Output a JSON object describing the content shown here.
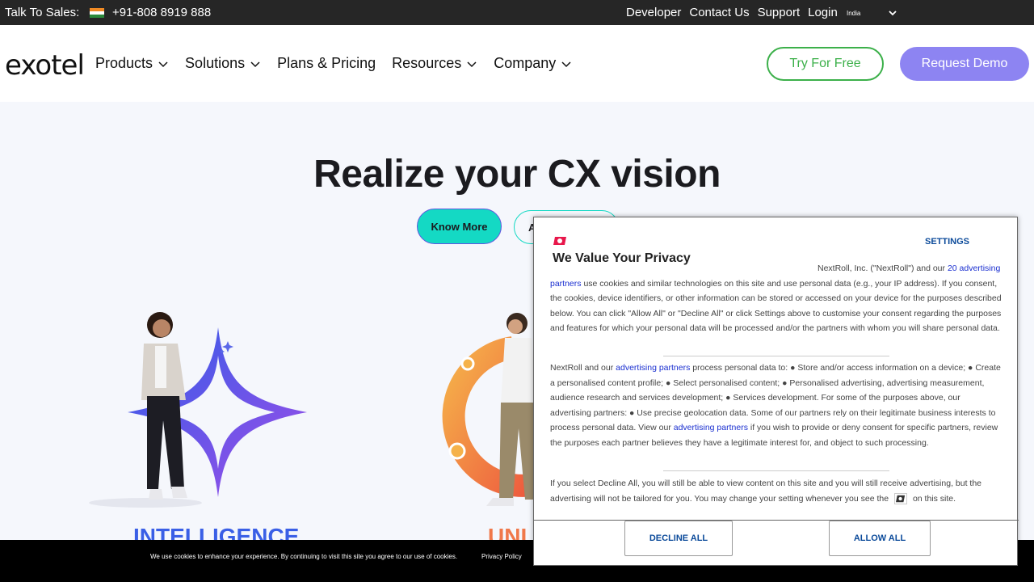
{
  "topbar": {
    "sales_label": "Talk To Sales:",
    "phone": "+91-808 8919 888",
    "links": [
      "Developer",
      "Contact Us",
      "Support",
      "Login"
    ],
    "region": "India"
  },
  "header": {
    "logo": "exotel",
    "nav": [
      "Products",
      "Solutions",
      "Plans & Pricing",
      "Resources",
      "Company"
    ],
    "try_label": "Try For Free",
    "demo_label": "Request Demo"
  },
  "hero": {
    "title": "Realize your CX vision",
    "know_more": "Know More",
    "second_button": "A",
    "intel_label": "INTELLIGENCE",
    "unified_label": "UNI"
  },
  "cookiebar": {
    "message": "We use cookies to enhance your experience. By continuing to visit this site you agree to our use of cookies.",
    "privacy_link": "Privacy Policy"
  },
  "privacy": {
    "settings": "SETTINGS",
    "title": "We Value Your Privacy",
    "p1_start": "NextRoll, Inc. (\"NextRoll\") and our",
    "p1_link": "20 advertising partners",
    "p1_rest": "use cookies and similar technologies on this site and use personal data (e.g., your IP address). If you consent, the cookies, device identifiers, or other information can be stored or accessed on your device for the purposes described below. You can click \"Allow All\" or \"Decline All\" or click Settings above to customise your consent regarding the purposes and features for which your personal data will be processed and/or the partners with whom you will share personal data.",
    "p2_start": "NextRoll and our",
    "p2_link1": "advertising partners",
    "p2_mid": "process personal data to: ● Store and/or access information on a device; ● Create a personalised content profile; ● Select personalised content; ● Personalised advertising, advertising measurement, audience research and services development; ● Services development. For some of the purposes above, our advertising partners: ● Use precise geolocation data. Some of our partners rely on their legitimate business interests to process personal data. View our",
    "p2_link2": "advertising partners",
    "p2_end": "if you wish to provide or deny consent for specific partners, review the purposes each partner believes they have a legitimate interest for, and object to such processing.",
    "p3_start": "If you select Decline All, you will still be able to view content on this site and you will still receive advertising, but the advertising will not be tailored for you. You may change your setting whenever you see the",
    "p3_end": "on this site.",
    "decline": "DECLINE ALL",
    "allow": "ALLOW ALL"
  }
}
